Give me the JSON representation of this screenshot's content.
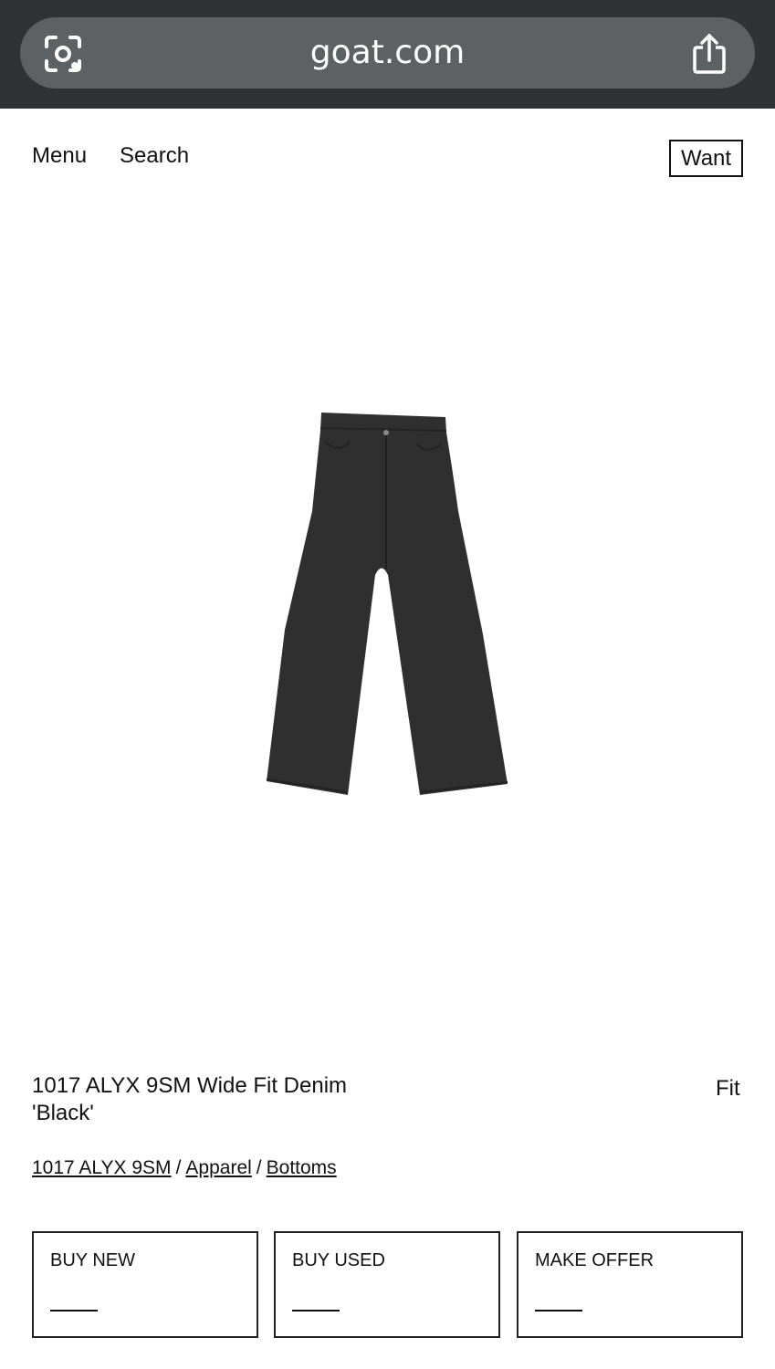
{
  "browser": {
    "url": "goat.com",
    "left_icon": "lens-icon",
    "right_icon": "share-icon"
  },
  "header": {
    "menu_label": "Menu",
    "search_label": "Search",
    "want_label": "Want"
  },
  "product": {
    "image_icon": "black-wide-fit-jeans",
    "title": "1017 ALYX 9SM Wide Fit Denim 'Black'",
    "fit_label": "Fit",
    "breadcrumbs": [
      "1017 ALYX 9SM",
      "Apparel",
      "Bottoms"
    ],
    "breadcrumb_separator": "/"
  },
  "purchase_options": [
    {
      "label": "BUY NEW",
      "price": ""
    },
    {
      "label": "BUY USED",
      "price": ""
    },
    {
      "label": "MAKE OFFER",
      "price": ""
    }
  ],
  "colors": {
    "browser_chrome": "#2f3335",
    "url_pill": "#5d6163",
    "denim": "#2f2f30",
    "text": "#111111"
  }
}
